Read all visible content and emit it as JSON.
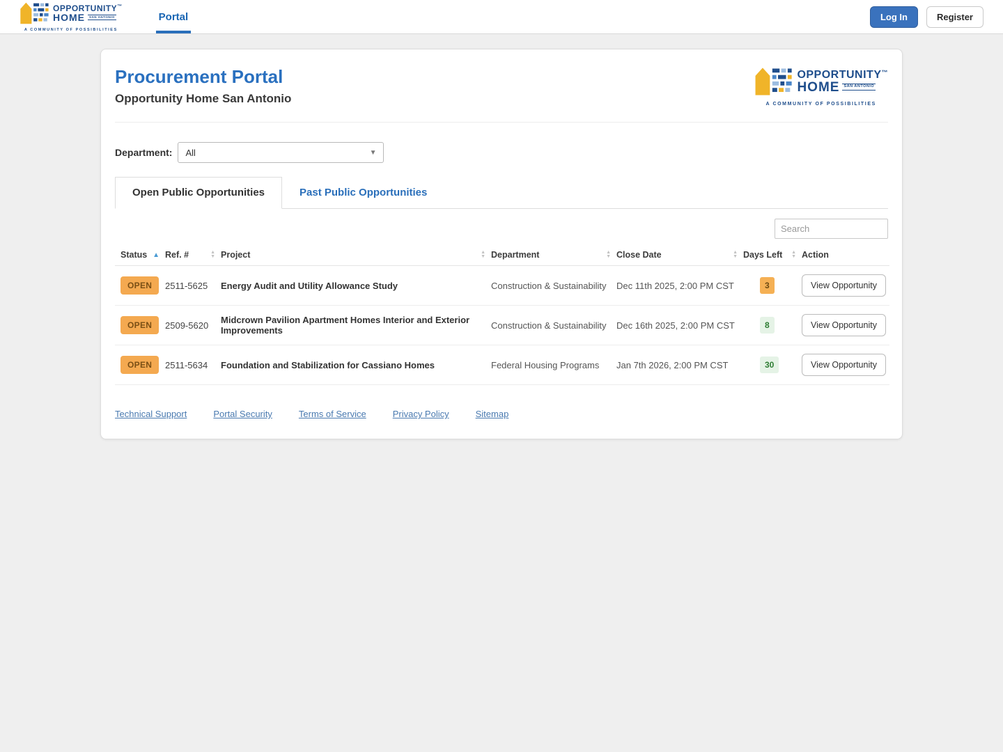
{
  "navbar": {
    "portal_link": "Portal",
    "login_button": "Log In",
    "register_button": "Register"
  },
  "logo": {
    "line1": "OPPORTUNITY",
    "trademark": "™",
    "line2": "HOME",
    "sub": "SAN ANTONIO",
    "tagline": "A COMMUNITY OF POSSIBILITIES"
  },
  "header": {
    "title": "Procurement Portal",
    "subtitle": "Opportunity Home San Antonio"
  },
  "filters": {
    "department_label": "Department:",
    "department_value": "All"
  },
  "tabs": [
    {
      "label": "Open Public Opportunities",
      "active": true
    },
    {
      "label": "Past Public Opportunities",
      "active": false
    }
  ],
  "search": {
    "placeholder": "Search"
  },
  "table": {
    "columns": [
      "Status",
      "Ref. #",
      "Project",
      "Department",
      "Close Date",
      "Days Left",
      "Action"
    ],
    "sorted_column": "Status",
    "sort_direction": "ascending",
    "rows": [
      {
        "status": "OPEN",
        "ref": "2511-5625",
        "project": "Energy Audit and Utility Allowance Study",
        "department": "Construction & Sustainability",
        "close_date": "Dec 11th 2025, 2:00 PM CST",
        "days_left": "3",
        "days_left_level": "warning",
        "action": "View Opportunity"
      },
      {
        "status": "OPEN",
        "ref": "2509-5620",
        "project": "Midcrown Pavilion Apartment Homes Interior and Exterior Improvements",
        "department": "Construction & Sustainability",
        "close_date": "Dec 16th 2025, 2:00 PM CST",
        "days_left": "8",
        "days_left_level": "ok",
        "action": "View Opportunity"
      },
      {
        "status": "OPEN",
        "ref": "2511-5634",
        "project": "Foundation and Stabilization for Cassiano Homes",
        "department": "Federal Housing Programs",
        "close_date": "Jan 7th 2026, 2:00 PM CST",
        "days_left": "30",
        "days_left_level": "ok",
        "action": "View Opportunity"
      }
    ]
  },
  "footer": {
    "links": [
      "Technical Support",
      "Portal Security",
      "Terms of Service",
      "Privacy Policy",
      "Sitemap"
    ]
  },
  "colors": {
    "accent_blue": "#2a6fba",
    "logo_blue": "#1f4e8c",
    "logo_yellow": "#f0b429",
    "open_badge_bg": "#f4a950",
    "open_badge_text": "#7a4f15",
    "days_warning_bg": "#f5b054",
    "days_ok_bg": "#e5f3e6",
    "days_ok_text": "#2e7d33"
  }
}
